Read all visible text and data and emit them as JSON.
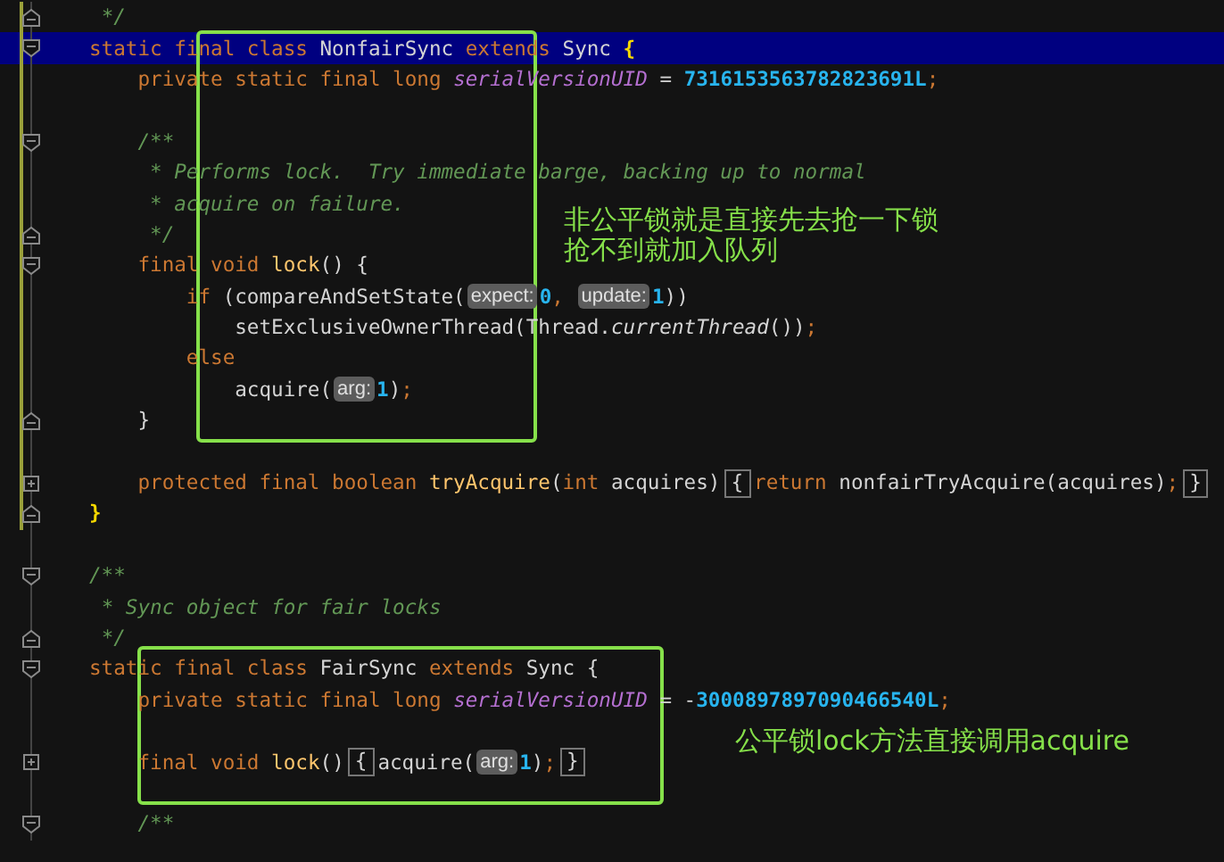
{
  "editor": {
    "lines": [
      {
        "kind": "closer",
        "changed": true,
        "highlighted": false,
        "tokens": [
          {
            "kind": "comment",
            "text": " */"
          }
        ]
      },
      {
        "kind": "opener",
        "changed": true,
        "highlighted": true,
        "tokens": [
          {
            "kind": "keyword",
            "text": "static final class "
          },
          {
            "kind": "plain",
            "text": "NonfairSync "
          },
          {
            "kind": "keyword",
            "text": "extends "
          },
          {
            "kind": "plain",
            "text": "Sync "
          },
          {
            "kind": "brace",
            "text": "{"
          }
        ]
      },
      {
        "kind": "plain",
        "changed": true,
        "highlighted": false,
        "tokens": [
          {
            "kind": "keyword",
            "text": "    private static final long "
          },
          {
            "kind": "field",
            "text": "serialVersionUID"
          },
          {
            "kind": "plain",
            "text": " = "
          },
          {
            "kind": "number",
            "text": "7316153563782823691L"
          },
          {
            "kind": "keyword",
            "text": ";"
          }
        ]
      },
      {
        "kind": "plain",
        "changed": true,
        "highlighted": false
      },
      {
        "kind": "opener",
        "changed": true,
        "highlighted": false,
        "tokens": [
          {
            "kind": "comment",
            "text": "    /**"
          }
        ]
      },
      {
        "kind": "plain",
        "changed": true,
        "highlighted": false,
        "tokens": [
          {
            "kind": "comment",
            "text": "     * Performs lock.  Try immediate barge, backing up to normal"
          }
        ]
      },
      {
        "kind": "plain",
        "changed": true,
        "highlighted": false,
        "tokens": [
          {
            "kind": "comment",
            "text": "     * acquire on failure."
          }
        ]
      },
      {
        "kind": "closer",
        "changed": true,
        "highlighted": false,
        "tokens": [
          {
            "kind": "comment",
            "text": "     */"
          }
        ]
      },
      {
        "kind": "opener",
        "changed": true,
        "highlighted": false,
        "tokens": [
          {
            "kind": "keyword",
            "text": "    final void "
          },
          {
            "kind": "method",
            "text": "lock"
          },
          {
            "kind": "plain",
            "text": "() {"
          }
        ]
      },
      {
        "kind": "plain",
        "changed": true,
        "highlighted": false,
        "tokens": [
          {
            "kind": "keyword",
            "text": "        if "
          },
          {
            "kind": "plain",
            "text": "(compareAndSetState("
          },
          {
            "kind": "hint",
            "text": "expect:"
          },
          {
            "kind": "number",
            "text": "0"
          },
          {
            "kind": "keyword",
            "text": ", "
          },
          {
            "kind": "hint",
            "text": "update:"
          },
          {
            "kind": "number",
            "text": "1"
          },
          {
            "kind": "plain",
            "text": "))"
          }
        ]
      },
      {
        "kind": "plain",
        "changed": true,
        "highlighted": false,
        "tokens": [
          {
            "kind": "plain",
            "text": "            setExclusiveOwnerThread(Thread."
          },
          {
            "kind": "italic",
            "text": "currentThread"
          },
          {
            "kind": "plain",
            "text": "())"
          },
          {
            "kind": "keyword",
            "text": ";"
          }
        ]
      },
      {
        "kind": "plain",
        "changed": true,
        "highlighted": false,
        "tokens": [
          {
            "kind": "keyword",
            "text": "        else"
          }
        ]
      },
      {
        "kind": "plain",
        "changed": true,
        "highlighted": false,
        "tokens": [
          {
            "kind": "plain",
            "text": "            acquire("
          },
          {
            "kind": "hint",
            "text": "arg:"
          },
          {
            "kind": "number",
            "text": "1"
          },
          {
            "kind": "plain",
            "text": ")"
          },
          {
            "kind": "keyword",
            "text": ";"
          }
        ]
      },
      {
        "kind": "closer",
        "changed": true,
        "highlighted": false,
        "tokens": [
          {
            "kind": "plain",
            "text": "    }"
          }
        ]
      },
      {
        "kind": "plain",
        "changed": true,
        "highlighted": false
      },
      {
        "kind": "collapsed",
        "changed": true,
        "highlighted": false,
        "tokens": [
          {
            "kind": "keyword",
            "text": "    protected final boolean "
          },
          {
            "kind": "method",
            "text": "tryAcquire"
          },
          {
            "kind": "plain",
            "text": "("
          },
          {
            "kind": "keyword",
            "text": "int "
          },
          {
            "kind": "plain",
            "text": "acquires)"
          },
          {
            "kind": "folded",
            "text": "{"
          },
          {
            "kind": "keyword",
            "text": "return "
          },
          {
            "kind": "plain",
            "text": "nonfairTryAcquire(acquires)"
          },
          {
            "kind": "keyword",
            "text": ";"
          },
          {
            "kind": "folded",
            "text": "}"
          }
        ]
      },
      {
        "kind": "closer",
        "changed": true,
        "highlighted": false,
        "tokens": [
          {
            "kind": "brace",
            "text": "}"
          }
        ]
      },
      {
        "kind": "plain",
        "changed": false,
        "highlighted": false
      },
      {
        "kind": "opener",
        "changed": false,
        "highlighted": false,
        "tokens": [
          {
            "kind": "comment",
            "text": "/**"
          }
        ]
      },
      {
        "kind": "plain",
        "changed": false,
        "highlighted": false,
        "tokens": [
          {
            "kind": "comment",
            "text": " * Sync object for fair locks"
          }
        ]
      },
      {
        "kind": "closer",
        "changed": false,
        "highlighted": false,
        "tokens": [
          {
            "kind": "comment",
            "text": " */"
          }
        ]
      },
      {
        "kind": "opener",
        "changed": false,
        "highlighted": false,
        "tokens": [
          {
            "kind": "keyword",
            "text": "static final class "
          },
          {
            "kind": "plain",
            "text": "FairSync "
          },
          {
            "kind": "keyword",
            "text": "extends "
          },
          {
            "kind": "plain",
            "text": "Sync {"
          }
        ]
      },
      {
        "kind": "plain",
        "changed": false,
        "highlighted": false,
        "tokens": [
          {
            "kind": "keyword",
            "text": "    private static final long "
          },
          {
            "kind": "field",
            "text": "serialVersionUID"
          },
          {
            "kind": "plain",
            "text": " = -"
          },
          {
            "kind": "number",
            "text": "3000897897090466540L"
          },
          {
            "kind": "keyword",
            "text": ";"
          }
        ]
      },
      {
        "kind": "plain",
        "changed": false,
        "highlighted": false
      },
      {
        "kind": "collapsed",
        "changed": false,
        "highlighted": false,
        "tokens": [
          {
            "kind": "keyword",
            "text": "    final void "
          },
          {
            "kind": "method",
            "text": "lock"
          },
          {
            "kind": "plain",
            "text": "()"
          },
          {
            "kind": "folded",
            "text": "{"
          },
          {
            "kind": "plain",
            "text": "acquire("
          },
          {
            "kind": "hint",
            "text": "arg:"
          },
          {
            "kind": "number",
            "text": "1"
          },
          {
            "kind": "plain",
            "text": ")"
          },
          {
            "kind": "keyword",
            "text": ";"
          },
          {
            "kind": "folded",
            "text": "}"
          }
        ]
      },
      {
        "kind": "plain",
        "changed": false,
        "highlighted": false
      },
      {
        "kind": "opener",
        "changed": false,
        "highlighted": false,
        "tokens": [
          {
            "kind": "comment",
            "text": "    /**"
          }
        ]
      }
    ]
  },
  "annotations": [
    {
      "lines": [
        "非公平锁就是直接先去抢一下锁",
        "抢不到就加入队列"
      ]
    },
    {
      "lines": [
        "公平锁lock方法直接调用acquire"
      ]
    }
  ]
}
